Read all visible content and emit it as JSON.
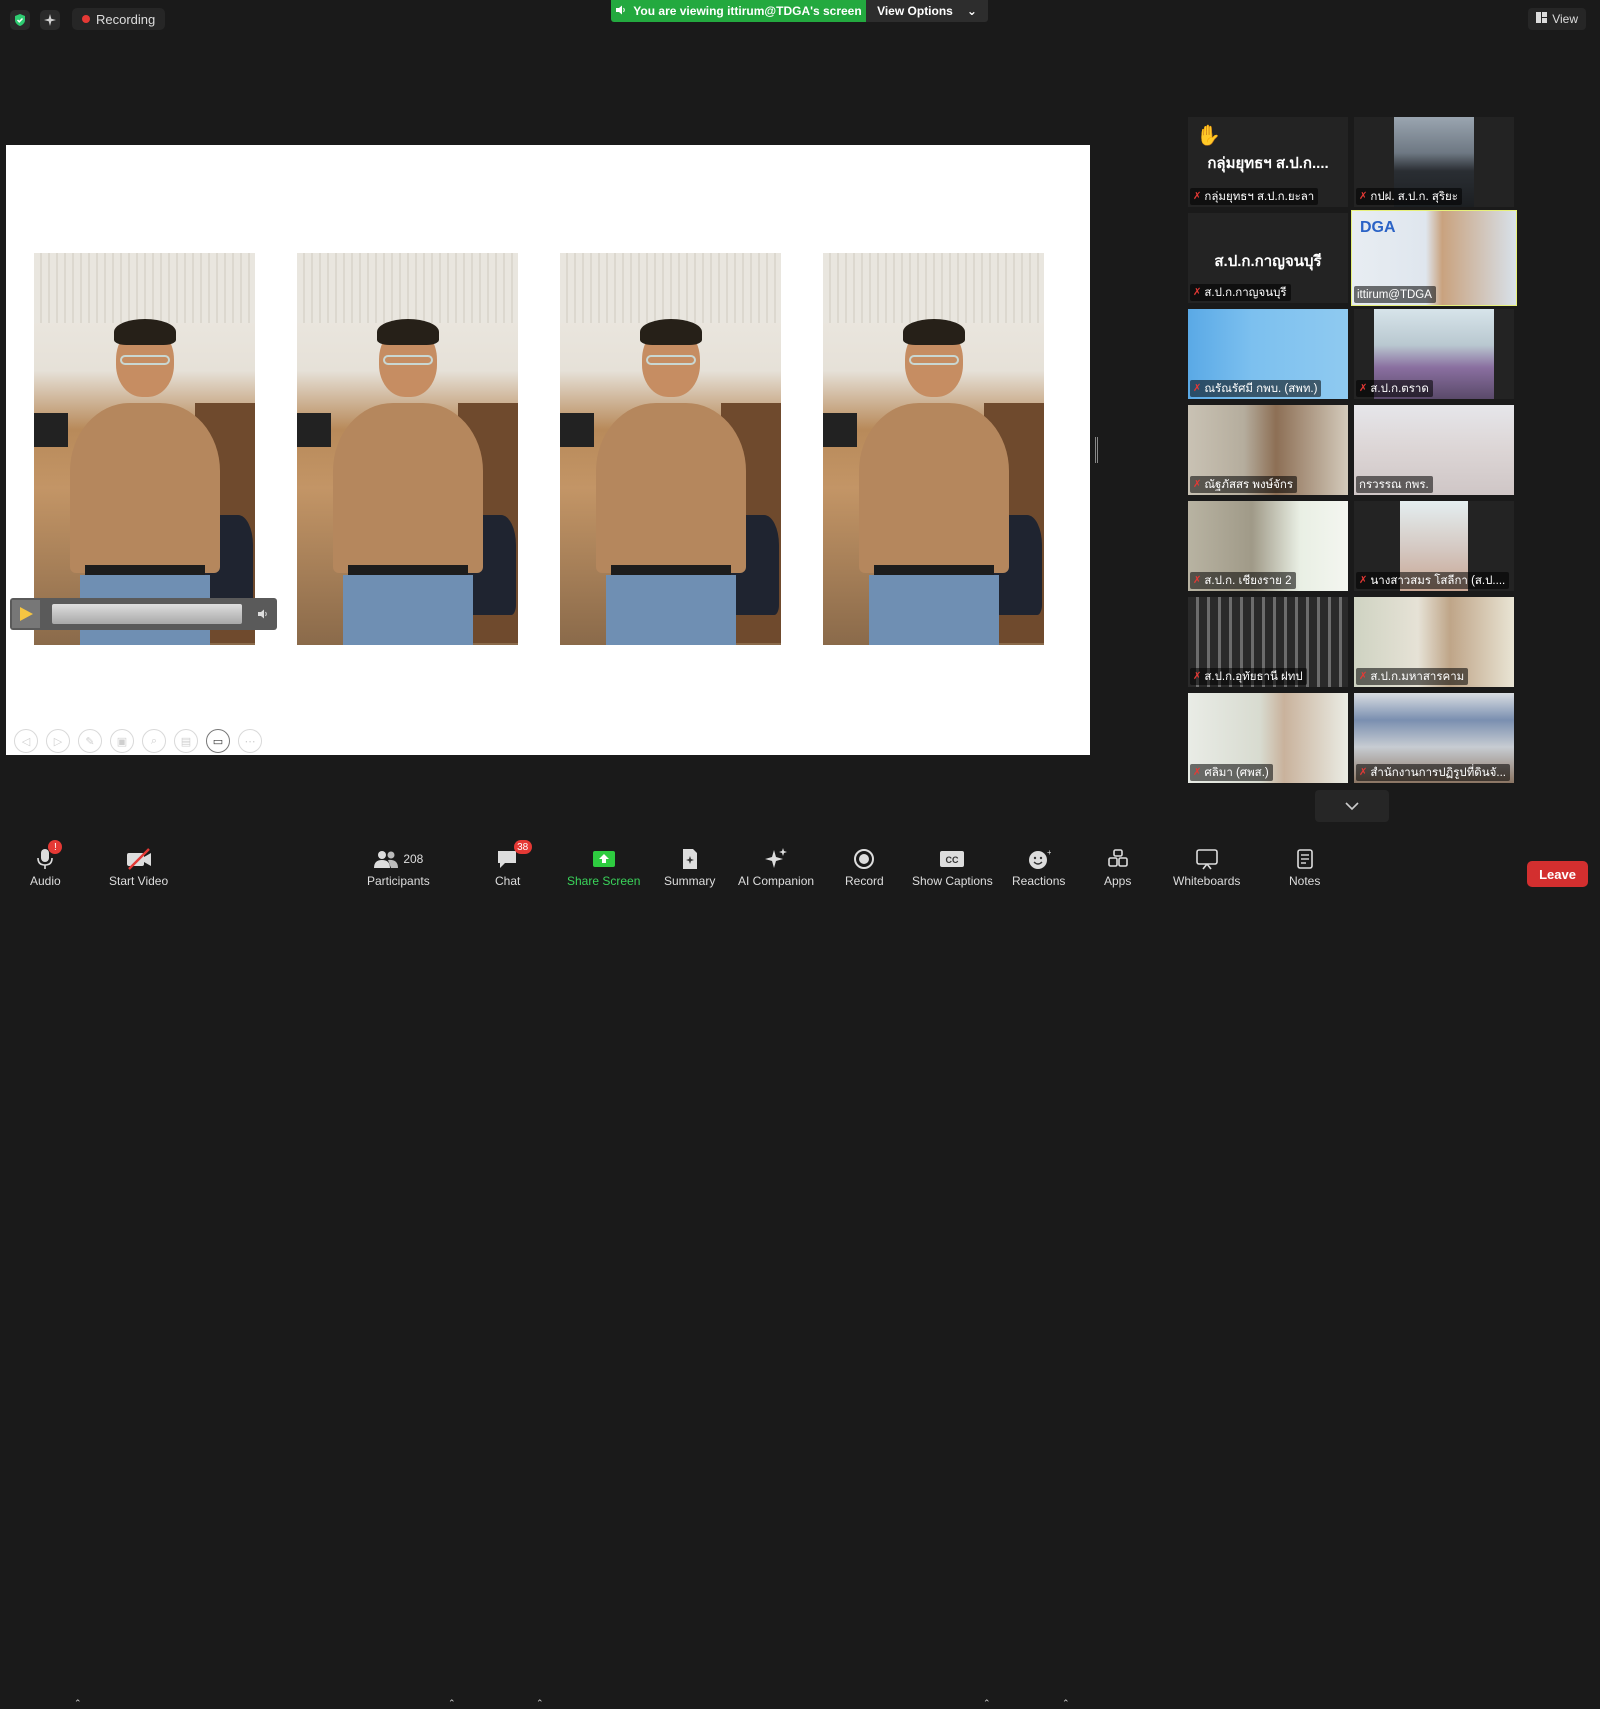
{
  "topbar": {
    "recording_label": "Recording",
    "viewing_banner": "You are viewing ittirum@TDGA's screen",
    "view_options_label": "View Options",
    "view_label": "View"
  },
  "gallery": {
    "tiles": [
      {
        "name": "กลุ่มยุทธฯ ส.ป.ก.ยะลา",
        "display": "กลุ่มยุทธฯ ส.ป.ก....",
        "muted": true,
        "hand_raised": true,
        "video": false
      },
      {
        "name": "กปฝ. ส.ป.ก. สุริยะ",
        "muted": true,
        "video": true
      },
      {
        "name": "ส.ป.ก.กาญจนบุรี",
        "display": "ส.ป.ก.กาญจนบุรี",
        "muted": true,
        "video": false
      },
      {
        "name": "ittirum@TDGA",
        "muted": false,
        "video": true,
        "active_speaker": true
      },
      {
        "name": "ณรัณรัศมี กพบ. (สพท.)",
        "muted": true,
        "video": true
      },
      {
        "name": "ส.ป.ก.ตราด",
        "muted": true,
        "video": true
      },
      {
        "name": "ณัฐภัสสร พงษ์จักร",
        "muted": true,
        "video": true
      },
      {
        "name": "กรวรรณ กพร.",
        "muted": false,
        "video": true
      },
      {
        "name": "ส.ป.ก. เชียงราย 2",
        "muted": true,
        "video": true
      },
      {
        "name": "นางสาวสมร โสลีกา (ส.ป....",
        "muted": true,
        "video": true
      },
      {
        "name": "ส.ป.ก.อุทัยธานี ฝทป",
        "muted": true,
        "video": true
      },
      {
        "name": "ส.ป.ก.มหาสารคาม",
        "muted": true,
        "video": true
      },
      {
        "name": "ศลิมา (ศพส.)",
        "muted": true,
        "video": true
      },
      {
        "name": "สำนักงานการปฏิรูปที่ดินจั...",
        "muted": true,
        "video": true
      }
    ]
  },
  "toolbar": {
    "audio_label": "Audio",
    "start_video_label": "Start Video",
    "participants_label": "Participants",
    "participants_count": "208",
    "chat_label": "Chat",
    "chat_badge": "38",
    "share_screen_label": "Share Screen",
    "summary_label": "Summary",
    "ai_companion_label": "AI Companion",
    "record_label": "Record",
    "show_captions_label": "Show Captions",
    "reactions_label": "Reactions",
    "apps_label": "Apps",
    "whiteboards_label": "Whiteboards",
    "notes_label": "Notes",
    "leave_label": "Leave"
  },
  "colors": {
    "accent_green": "#23a93f",
    "leave_red": "#d32f2f",
    "background": "#1a1a1a",
    "active_speaker_border": "#e7f07a"
  }
}
